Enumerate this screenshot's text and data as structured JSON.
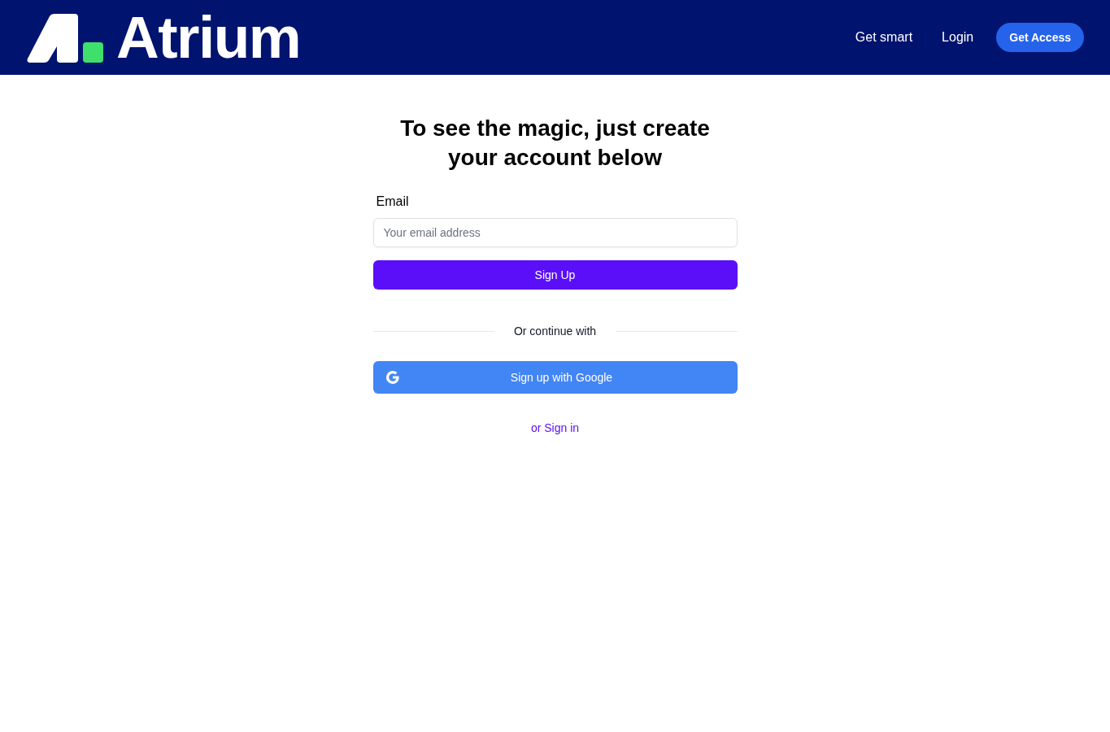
{
  "header": {
    "brand": "Atrium",
    "nav_links": [
      "Get smart",
      "Login"
    ],
    "cta": "Get Access"
  },
  "signup": {
    "heading": "To see the magic, just create your account below",
    "email_field": {
      "label": "Email",
      "placeholder": "Your email address"
    },
    "submit": "Sign Up",
    "divider": "Or continue with",
    "google_button": "Sign up with Google",
    "signin_link": "or Sign in"
  }
}
